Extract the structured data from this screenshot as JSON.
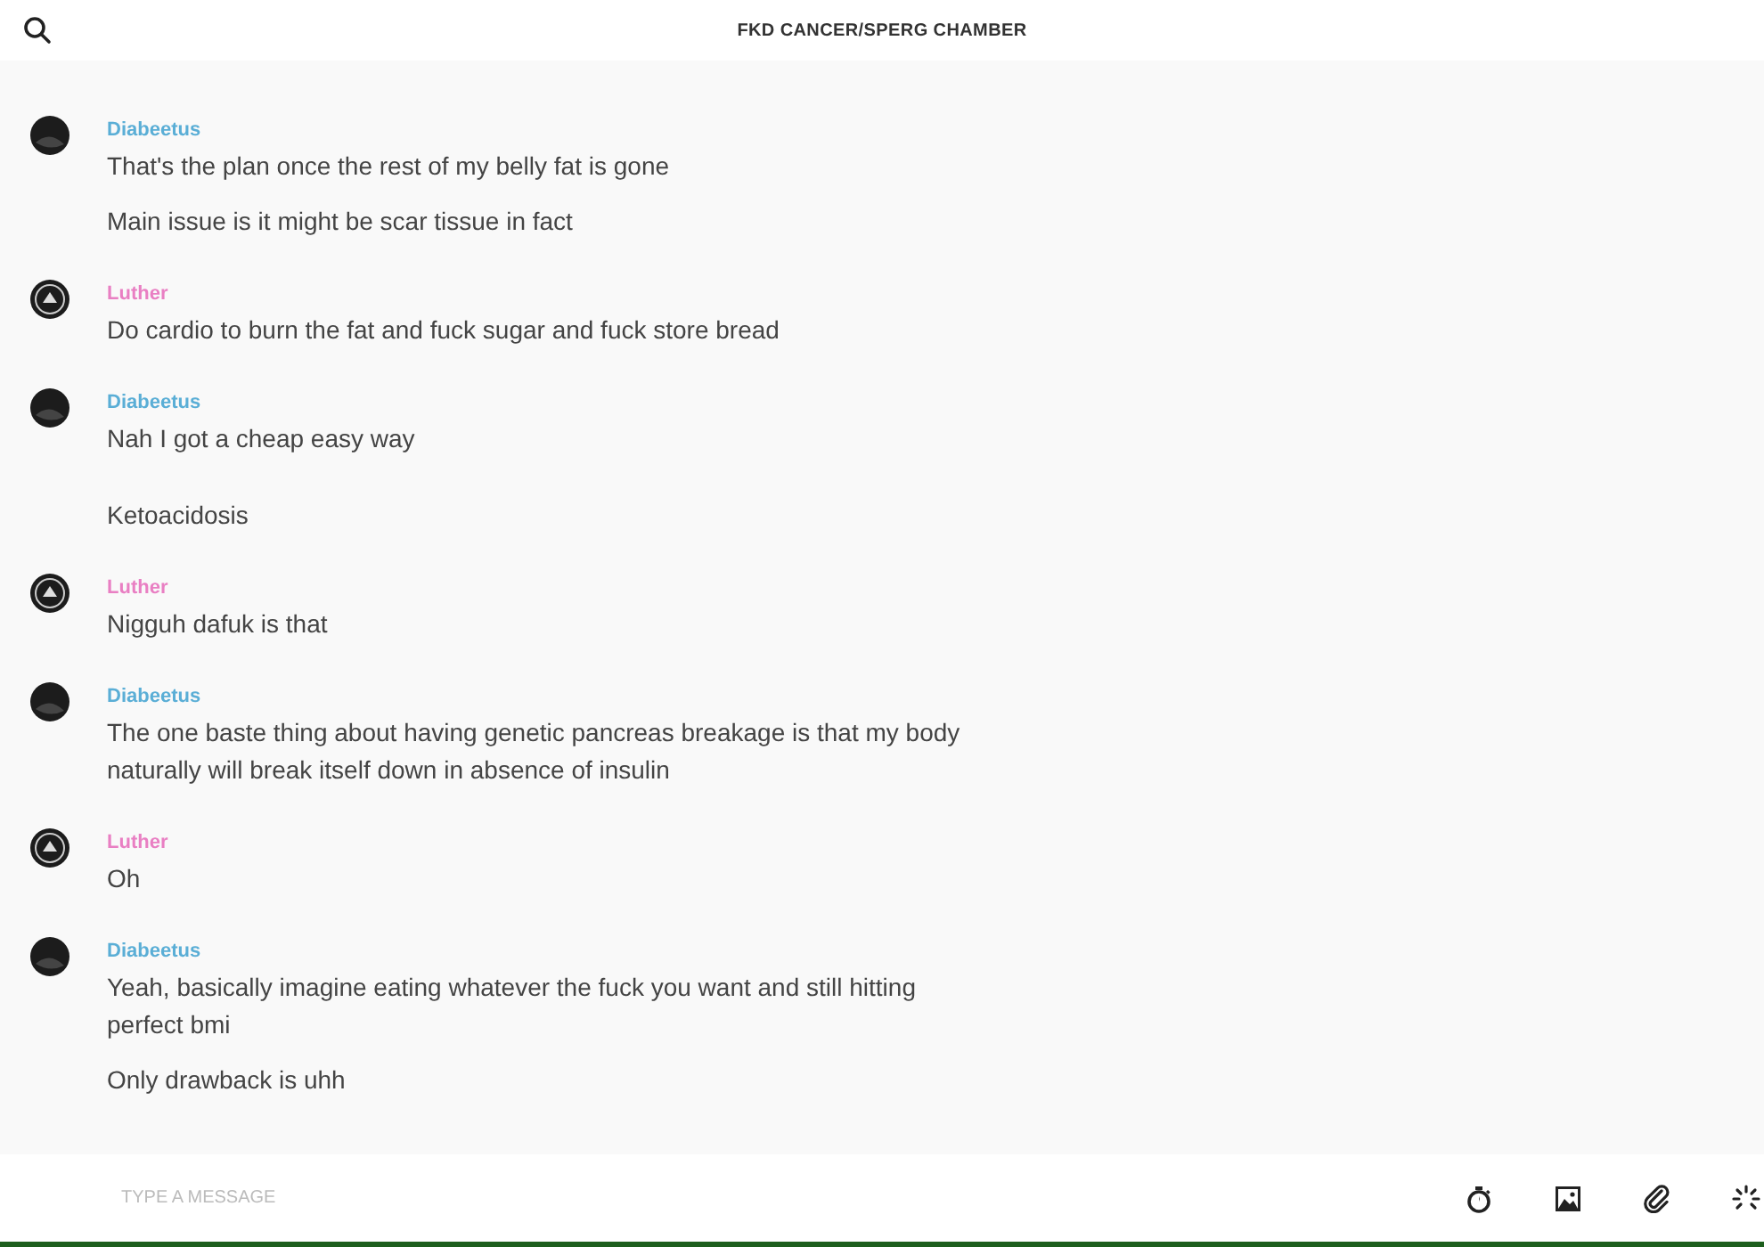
{
  "header": {
    "title": "FKD CANCER/SPERG CHAMBER"
  },
  "groups": [
    {
      "author": "Diabeetus",
      "color": "#5aaed6",
      "kind": "plain",
      "messages": [
        "That's the plan once the rest of my belly fat is gone",
        "Main issue is it might be scar tissue in fact"
      ]
    },
    {
      "author": "Luther",
      "color": "#e97fc3",
      "kind": "emblem",
      "messages": [
        "Do cardio to burn the fat and fuck sugar and fuck store bread"
      ]
    },
    {
      "author": "Diabeetus",
      "color": "#5aaed6",
      "kind": "plain",
      "messages": [
        "Nah I got a cheap easy way"
      ]
    },
    {
      "messages": [
        "Ketoacidosis"
      ]
    },
    {
      "author": "Luther",
      "color": "#e97fc3",
      "kind": "emblem",
      "messages": [
        "Nigguh dafuk is that"
      ]
    },
    {
      "author": "Diabeetus",
      "color": "#5aaed6",
      "kind": "plain",
      "messages": [
        "The one baste thing about having genetic pancreas breakage is that my body naturally will break itself down in absence of insulin"
      ]
    },
    {
      "author": "Luther",
      "color": "#e97fc3",
      "kind": "emblem",
      "messages": [
        "Oh"
      ]
    },
    {
      "author": "Diabeetus",
      "color": "#5aaed6",
      "kind": "plain",
      "messages": [
        "Yeah, basically imagine eating whatever the fuck you want and still hitting perfect bmi",
        "Only drawback is uhh"
      ]
    }
  ],
  "composer": {
    "placeholder": "TYPE A MESSAGE"
  }
}
